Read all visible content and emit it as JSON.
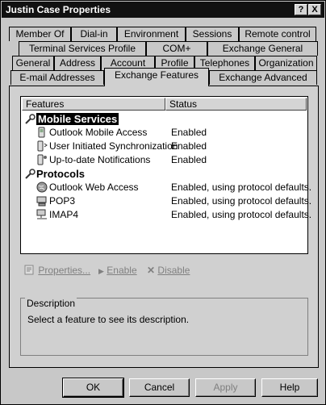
{
  "window": {
    "title": "Justin Case Properties",
    "help_btn": "?",
    "close_btn": "X"
  },
  "tabs": {
    "row1": [
      "Member Of",
      "Dial-in",
      "Environment",
      "Sessions",
      "Remote control"
    ],
    "row2": [
      "Terminal Services Profile",
      "COM+",
      "Exchange General"
    ],
    "row3": [
      "General",
      "Address",
      "Account",
      "Profile",
      "Telephones",
      "Organization"
    ],
    "row4": [
      "E-mail Addresses",
      "Exchange Features",
      "Exchange Advanced"
    ],
    "active": "Exchange Features"
  },
  "features": {
    "col_features": "Features",
    "col_status": "Status",
    "groups": [
      {
        "label": "Mobile Services",
        "items": [
          {
            "label": "Outlook Mobile Access",
            "status": "Enabled",
            "icon": "mobile-device-icon"
          },
          {
            "label": "User Initiated Synchronization",
            "status": "Enabled",
            "icon": "mobile-sync-icon"
          },
          {
            "label": "Up-to-date Notifications",
            "status": "Enabled",
            "icon": "mobile-notify-icon"
          }
        ]
      },
      {
        "label": "Protocols",
        "items": [
          {
            "label": "Outlook Web Access",
            "status": "Enabled, using protocol defaults.",
            "icon": "globe-icon"
          },
          {
            "label": "POP3",
            "status": "Enabled, using protocol defaults.",
            "icon": "computer-icon"
          },
          {
            "label": "IMAP4",
            "status": "Enabled, using protocol defaults.",
            "icon": "network-computer-icon"
          }
        ]
      }
    ]
  },
  "toolbar": {
    "properties": "Properties...",
    "enable": "Enable",
    "disable": "Disable"
  },
  "description": {
    "legend": "Description",
    "text": "Select a feature to see its description."
  },
  "buttons": {
    "ok": "OK",
    "cancel": "Cancel",
    "apply": "Apply",
    "help": "Help"
  }
}
